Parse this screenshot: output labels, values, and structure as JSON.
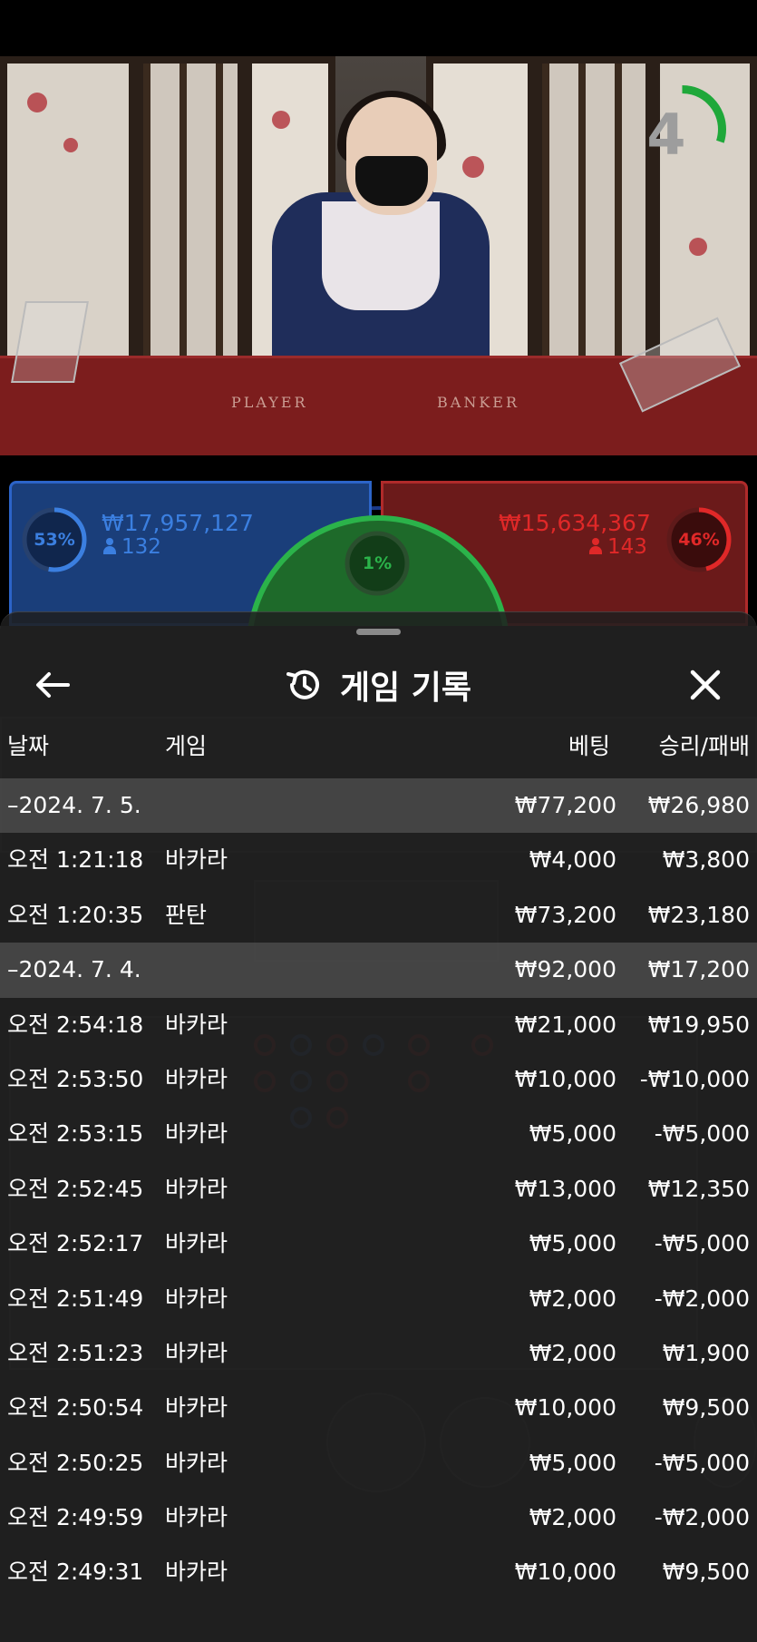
{
  "timer": {
    "value": "4",
    "progress": 0.3
  },
  "table_labels": {
    "player": "PLAYER",
    "banker": "BANKER"
  },
  "player_bet": {
    "percent": "53%",
    "percent_value": 0.53,
    "amount": "₩17,957,127",
    "count": "132",
    "color": "#3b7fe0"
  },
  "banker_bet": {
    "percent": "46%",
    "percent_value": 0.46,
    "amount": "₩15,634,367",
    "count": "143",
    "color": "#e02828"
  },
  "tie_bet": {
    "percent": "1%",
    "color": "#2bb34a"
  },
  "history": {
    "title": "게임 기록",
    "columns": {
      "date": "날짜",
      "game": "게임",
      "bet": "베팅",
      "result": "승리/패배"
    },
    "rows": [
      {
        "type": "date",
        "date": "–2024. 7. 5.",
        "bet": "₩77,200",
        "result": "₩26,980"
      },
      {
        "type": "entry",
        "time": "오전 1:21:18",
        "game": "바카라",
        "bet": "₩4,000",
        "result": "₩3,800"
      },
      {
        "type": "entry",
        "time": "오전 1:20:35",
        "game": "판탄",
        "bet": "₩73,200",
        "result": "₩23,180"
      },
      {
        "type": "date",
        "date": "–2024. 7. 4.",
        "bet": "₩92,000",
        "result": "₩17,200"
      },
      {
        "type": "entry",
        "time": "오전 2:54:18",
        "game": "바카라",
        "bet": "₩21,000",
        "result": "₩19,950"
      },
      {
        "type": "entry",
        "time": "오전 2:53:50",
        "game": "바카라",
        "bet": "₩10,000",
        "result": "-₩10,000"
      },
      {
        "type": "entry",
        "time": "오전 2:53:15",
        "game": "바카라",
        "bet": "₩5,000",
        "result": "-₩5,000"
      },
      {
        "type": "entry",
        "time": "오전 2:52:45",
        "game": "바카라",
        "bet": "₩13,000",
        "result": "₩12,350"
      },
      {
        "type": "entry",
        "time": "오전 2:52:17",
        "game": "바카라",
        "bet": "₩5,000",
        "result": "-₩5,000"
      },
      {
        "type": "entry",
        "time": "오전 2:51:49",
        "game": "바카라",
        "bet": "₩2,000",
        "result": "-₩2,000"
      },
      {
        "type": "entry",
        "time": "오전 2:51:23",
        "game": "바카라",
        "bet": "₩2,000",
        "result": "₩1,900"
      },
      {
        "type": "entry",
        "time": "오전 2:50:54",
        "game": "바카라",
        "bet": "₩10,000",
        "result": "₩9,500"
      },
      {
        "type": "entry",
        "time": "오전 2:50:25",
        "game": "바카라",
        "bet": "₩5,000",
        "result": "-₩5,000"
      },
      {
        "type": "entry",
        "time": "오전 2:49:59",
        "game": "바카라",
        "bet": "₩2,000",
        "result": "-₩2,000"
      },
      {
        "type": "entry",
        "time": "오전 2:49:31",
        "game": "바카라",
        "bet": "₩10,000",
        "result": "₩9,500"
      }
    ]
  },
  "icons": {
    "back": "arrow-left-icon",
    "close": "close-icon",
    "history": "history-icon",
    "user": "user-icon"
  }
}
